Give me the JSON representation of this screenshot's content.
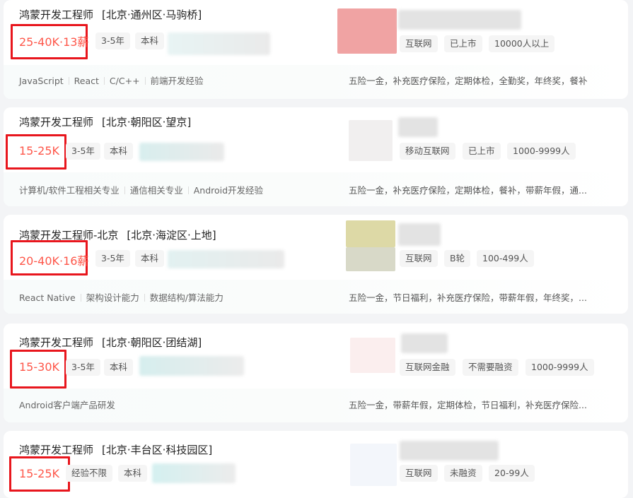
{
  "jobs": [
    {
      "title": "鸿蒙开发工程师",
      "area": "[北京·通州区·马驹桥]",
      "salary": "25-40K·13薪",
      "experience": "3-5年",
      "degree": "本科",
      "skills": [
        "JavaScript",
        "React",
        "C/C++",
        "前端开发经验"
      ],
      "company_tags": [
        "互联网",
        "已上市",
        "10000人以上"
      ],
      "welfare": "五险一金，补充医疗保险，定期体检，全勤奖，年终奖，餐补",
      "logo_color": "#f0a3a3"
    },
    {
      "title": "鸿蒙开发工程师",
      "area": "[北京·朝阳区·望京]",
      "salary": "15-25K",
      "experience": "3-5年",
      "degree": "本科",
      "skills": [
        "计算机/软件工程相关专业",
        "通信相关专业",
        "Android开发经验"
      ],
      "company_tags": [
        "移动互联网",
        "已上市",
        "1000-9999人"
      ],
      "welfare": "五险一金，补充医疗保险，定期体检，餐补，带薪年假，通...",
      "logo_color": "#f1efef"
    },
    {
      "title": "鸿蒙开发工程师-北京",
      "area": "[北京·海淀区·上地]",
      "salary": "20-40K·16薪",
      "experience": "3-5年",
      "degree": "本科",
      "skills": [
        "React Native",
        "架构设计能力",
        "数据结构/算法能力"
      ],
      "company_tags": [
        "互联网",
        "B轮",
        "100-499人"
      ],
      "welfare": "五险一金，节日福利，补充医疗保险，带薪年假，年终奖，...",
      "logo_color": "#ddd9a6"
    },
    {
      "title": "鸿蒙开发工程师",
      "area": "[北京·朝阳区·团结湖]",
      "salary": "15-30K",
      "experience": "3-5年",
      "degree": "本科",
      "skills": [
        "Android客户端产品研发"
      ],
      "company_tags": [
        "互联网金融",
        "不需要融资",
        "1000-9999人"
      ],
      "welfare": "五险一金，带薪年假，定期体检，节日福利，补充医疗保险...",
      "logo_color": "#fbeeee"
    },
    {
      "title": "鸿蒙开发工程师",
      "area": "[北京·丰台区·科技园区]",
      "salary": "15-25K",
      "experience": "经验不限",
      "degree": "本科",
      "skills": [],
      "company_tags": [
        "互联网",
        "未融资",
        "20-99人"
      ],
      "welfare": "",
      "logo_color": "#f3f6fb"
    }
  ],
  "colors": {
    "salary": "#fe574a",
    "highlight_box": "#e8161d"
  }
}
